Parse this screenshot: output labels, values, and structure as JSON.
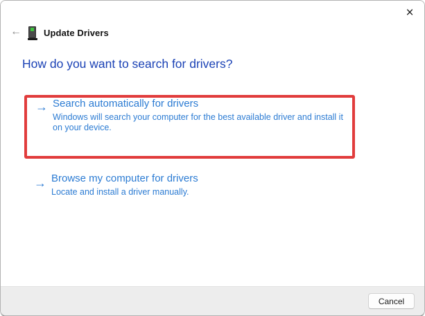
{
  "window": {
    "header": {
      "title": "Update Drivers"
    },
    "heading": "How do you want to search for drivers?",
    "options": [
      {
        "title": "Search automatically for drivers",
        "description": "Windows will search your computer for the best available driver and install it on your device."
      },
      {
        "title": "Browse my computer for drivers",
        "description": "Locate and install a driver manually."
      }
    ],
    "footer": {
      "cancel_label": "Cancel"
    }
  },
  "glyphs": {
    "back_arrow": "←",
    "option_arrow": "→",
    "close": "×"
  },
  "colors": {
    "heading_blue": "#1a41b5",
    "link_blue": "#2b7bd3",
    "annotation_red": "#e13c3c",
    "footer_bg": "#ededed",
    "device_led_green": "#3fc43f"
  }
}
